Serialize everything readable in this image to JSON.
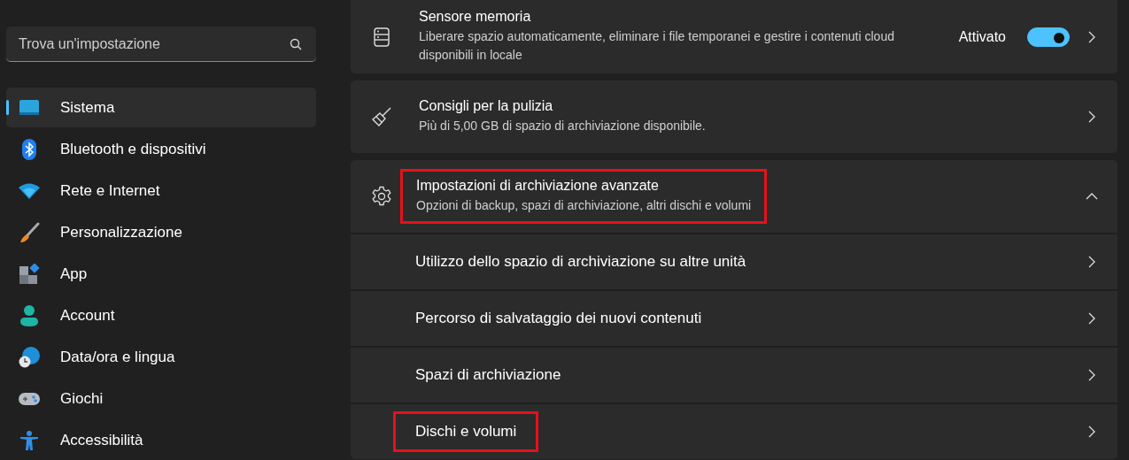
{
  "search": {
    "placeholder": "Trova un'impostazione"
  },
  "sidebar": {
    "items": [
      {
        "label": "Sistema",
        "selected": true
      },
      {
        "label": "Bluetooth e dispositivi",
        "selected": false
      },
      {
        "label": "Rete e Internet",
        "selected": false
      },
      {
        "label": "Personalizzazione",
        "selected": false
      },
      {
        "label": "App",
        "selected": false
      },
      {
        "label": "Account",
        "selected": false
      },
      {
        "label": "Data/ora e lingua",
        "selected": false
      },
      {
        "label": "Giochi",
        "selected": false
      },
      {
        "label": "Accessibilità",
        "selected": false
      }
    ]
  },
  "cards": [
    {
      "kind": "toggle",
      "title": "Sensore memoria",
      "description": "Liberare spazio automaticamente, eliminare i file temporanei e gestire i contenuti cloud disponibili in locale",
      "toggle_label": "Attivato",
      "on": true,
      "highlighted": false
    },
    {
      "kind": "link",
      "title": "Consigli per la pulizia",
      "description": "Più di 5,00 GB di spazio di archiviazione disponibile.",
      "highlighted": false
    },
    {
      "kind": "expander",
      "title": "Impostazioni di archiviazione avanzate",
      "description": "Opzioni di backup, spazi di archiviazione, altri dischi e volumi",
      "expanded": true,
      "highlighted": true,
      "children": [
        {
          "label": "Utilizzo dello spazio di archiviazione su altre unità",
          "highlighted": false
        },
        {
          "label": "Percorso di salvataggio dei nuovi contenuti",
          "highlighted": false
        },
        {
          "label": "Spazi di archiviazione",
          "highlighted": false
        },
        {
          "label": "Dischi e volumi",
          "highlighted": true
        }
      ]
    }
  ]
}
